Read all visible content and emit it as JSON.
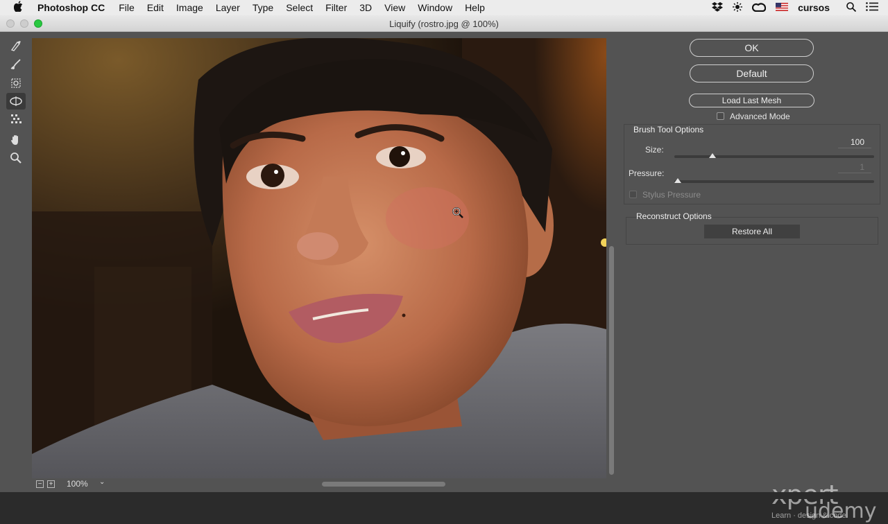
{
  "menubar": {
    "app_name": "Photoshop CC",
    "items": [
      "File",
      "Edit",
      "Image",
      "Layer",
      "Type",
      "Select",
      "Filter",
      "3D",
      "View",
      "Window",
      "Help"
    ],
    "user": "cursos",
    "icons": [
      "apple-icon",
      "dropbox-icon",
      "brightness-icon",
      "creative-cloud-icon",
      "us-flag-icon",
      "spotlight-search-icon",
      "menu-list-icon"
    ]
  },
  "window": {
    "title": "Liquify (rostro.jpg @ 100%)",
    "traffic_colors": [
      "#c8c8c8",
      "#c8c8c8",
      "#28c840"
    ]
  },
  "tools": [
    "forward-warp-tool-icon",
    "reconstruct-tool-icon",
    "pucker-tool-icon",
    "bloat-tool-icon",
    "push-left-tool-icon",
    "hand-tool-icon",
    "zoom-tool-icon"
  ],
  "status": {
    "zoom": "100%"
  },
  "panel": {
    "ok": "OK",
    "default": "Default",
    "load_last_mesh": "Load Last Mesh",
    "advanced_mode": "Advanced Mode",
    "brush_options": {
      "title": "Brush Tool Options",
      "size_label": "Size:",
      "size_value": "100",
      "size_fraction": 0.19,
      "pressure_label": "Pressure:",
      "pressure_value": "1",
      "pressure_fraction": 0.0,
      "stylus_pressure": "Stylus Pressure"
    },
    "reconstruct": {
      "title": "Reconstruct Options",
      "restore_all": "Restore All"
    }
  },
  "watermark": {
    "brand": "xpert",
    "brand2": "udemy",
    "sub": "Learn · design & code"
  },
  "colors": {
    "panel": "#535353",
    "accent_green": "#28c840"
  }
}
